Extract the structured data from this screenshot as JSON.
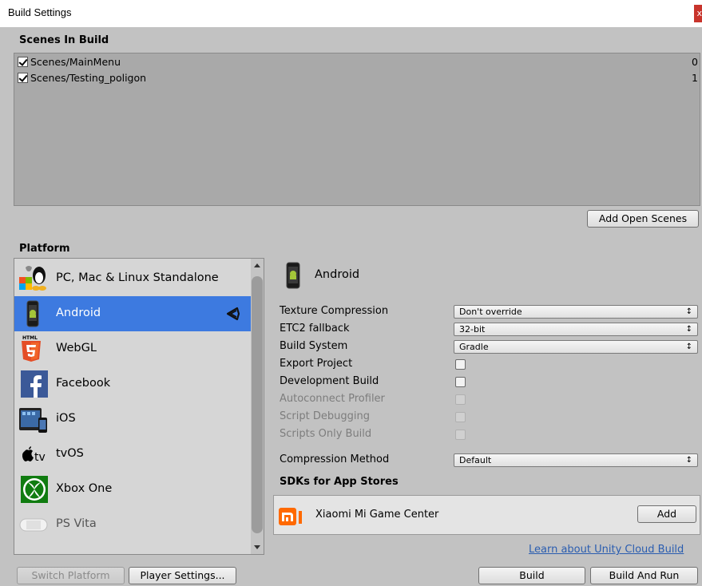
{
  "window": {
    "title": "Build Settings",
    "close_glyph": "x"
  },
  "scenes": {
    "header": "Scenes In Build",
    "items": [
      {
        "name": "Scenes/MainMenu",
        "index": "0",
        "checked": true
      },
      {
        "name": "Scenes/Testing_poligon",
        "index": "1",
        "checked": true
      }
    ],
    "add_open_scenes_label": "Add Open Scenes"
  },
  "platform": {
    "header": "Platform",
    "items": [
      {
        "label": "PC, Mac & Linux Standalone",
        "icon": "standalone-icon"
      },
      {
        "label": "Android",
        "icon": "android-phone-icon",
        "selected": true
      },
      {
        "label": "WebGL",
        "icon": "html5-icon"
      },
      {
        "label": "Facebook",
        "icon": "facebook-icon"
      },
      {
        "label": "iOS",
        "icon": "ios-devices-icon"
      },
      {
        "label": "tvOS",
        "icon": "appletv-icon",
        "prefix": "tv"
      },
      {
        "label": "Xbox One",
        "icon": "xbox-icon"
      },
      {
        "label": "PS Vita",
        "icon": "psvita-icon"
      }
    ]
  },
  "android": {
    "title": "Android",
    "settings": [
      {
        "label": "Texture Compression",
        "type": "dropdown",
        "value": "Don't override"
      },
      {
        "label": "ETC2 fallback",
        "type": "dropdown",
        "value": "32-bit"
      },
      {
        "label": "Build System",
        "type": "dropdown",
        "value": "Gradle"
      },
      {
        "label": "Export Project",
        "type": "checkbox",
        "enabled": true
      },
      {
        "label": "Development Build",
        "type": "checkbox",
        "enabled": true
      },
      {
        "label": "Autoconnect Profiler",
        "type": "checkbox",
        "enabled": false
      },
      {
        "label": "Script Debugging",
        "type": "checkbox",
        "enabled": false
      },
      {
        "label": "Scripts Only Build",
        "type": "checkbox",
        "enabled": false
      },
      {
        "label": "Compression Method",
        "type": "dropdown",
        "value": "Default"
      }
    ],
    "caret": "↕",
    "sdk_header": "SDKs for App Stores",
    "sdk": {
      "name": "Xiaomi Mi Game Center",
      "add_label": "Add",
      "logo_text": "mi"
    },
    "cloud_link": "Learn about Unity Cloud Build"
  },
  "buttons": {
    "switch_platform": "Switch Platform",
    "player_settings": "Player Settings...",
    "build": "Build",
    "build_and_run": "Build And Run"
  },
  "colors": {
    "selection": "#3d7ae0",
    "window_bg": "#c2c2c2",
    "link": "#2a5db0",
    "close": "#c8342c"
  }
}
